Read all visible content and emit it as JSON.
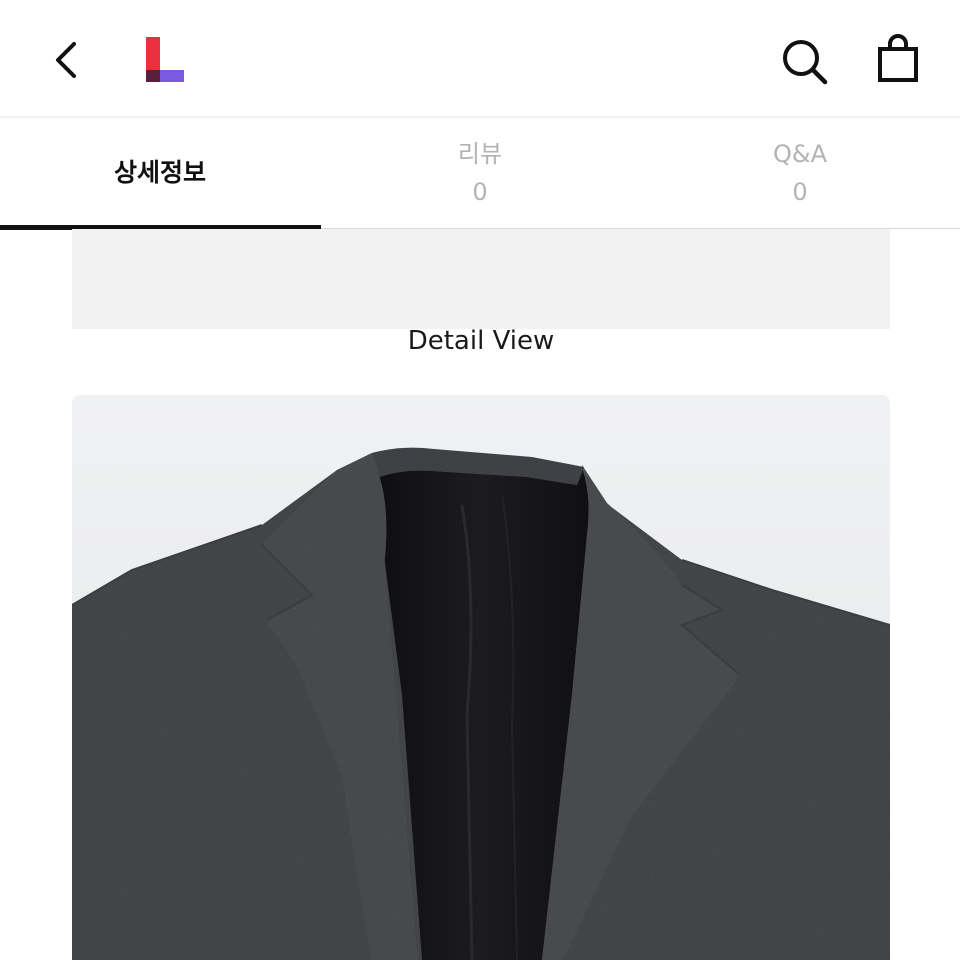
{
  "header": {
    "back_icon": "chevron-left-icon",
    "logo_icon": "l-logo-icon",
    "search_icon": "search-icon",
    "bag_icon": "shopping-bag-icon",
    "logo_colors": {
      "red": "#e8313c",
      "purple": "#7b5ce0",
      "dark": "#5a1e3c"
    }
  },
  "tabs": [
    {
      "label": "상세정보",
      "count": "",
      "active": true
    },
    {
      "label": "리뷰",
      "count": "0",
      "active": false
    },
    {
      "label": "Q&A",
      "count": "0",
      "active": false
    }
  ],
  "content": {
    "detail_title": "Detail View",
    "product_image": "charcoal-wool-blazer-photo"
  }
}
